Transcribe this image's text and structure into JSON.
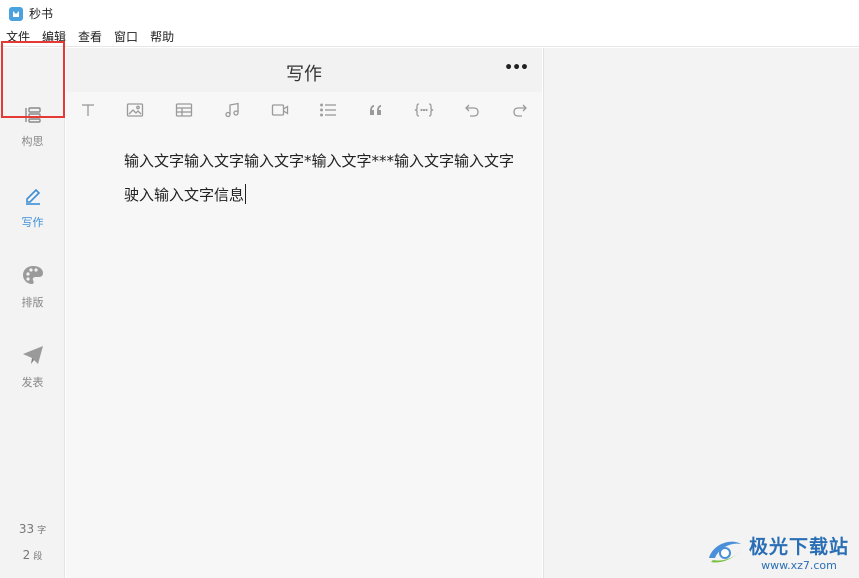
{
  "app": {
    "title": "秒书"
  },
  "menu": [
    "文件",
    "编辑",
    "查看",
    "窗口",
    "帮助"
  ],
  "sidebar": {
    "items": [
      {
        "label": "构思",
        "icon": "outline-icon"
      },
      {
        "label": "写作",
        "icon": "pen-icon"
      },
      {
        "label": "排版",
        "icon": "palette-icon"
      },
      {
        "label": "发表",
        "icon": "paper-plane-icon"
      }
    ],
    "active": "写作",
    "stats": {
      "chars": "33",
      "chars_unit": "字",
      "paras": "2",
      "paras_unit": "段"
    }
  },
  "editor": {
    "title": "写作",
    "more": "•••",
    "toolbar": [
      "text-icon",
      "image-icon",
      "table-icon",
      "music-icon",
      "video-icon",
      "list-icon",
      "quote-icon",
      "code-icon",
      "undo-icon",
      "redo-icon"
    ],
    "paragraphs": [
      "输入文字输入文字输入文字*输入文字***输入文字输入文字",
      "驶入输入文字信息"
    ]
  },
  "watermark": {
    "name": "极光下载站",
    "url": "www.xz7.com"
  },
  "colors": {
    "accent": "#3d8fd6",
    "highlight": "#e53935"
  }
}
